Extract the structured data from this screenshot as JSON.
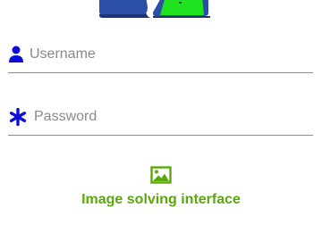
{
  "form": {
    "username": {
      "placeholder": "Username",
      "value": "",
      "icon": "user-icon"
    },
    "password": {
      "placeholder": "Password",
      "value": "",
      "icon": "asterisk-icon"
    }
  },
  "solver": {
    "icon": "image-icon",
    "label": "Image solving interface"
  },
  "colors": {
    "accent_blue": "#0a10d8",
    "green": "#5aa80a",
    "bright_green": "#1fe31f",
    "logo_blue": "#2b4fa6"
  }
}
